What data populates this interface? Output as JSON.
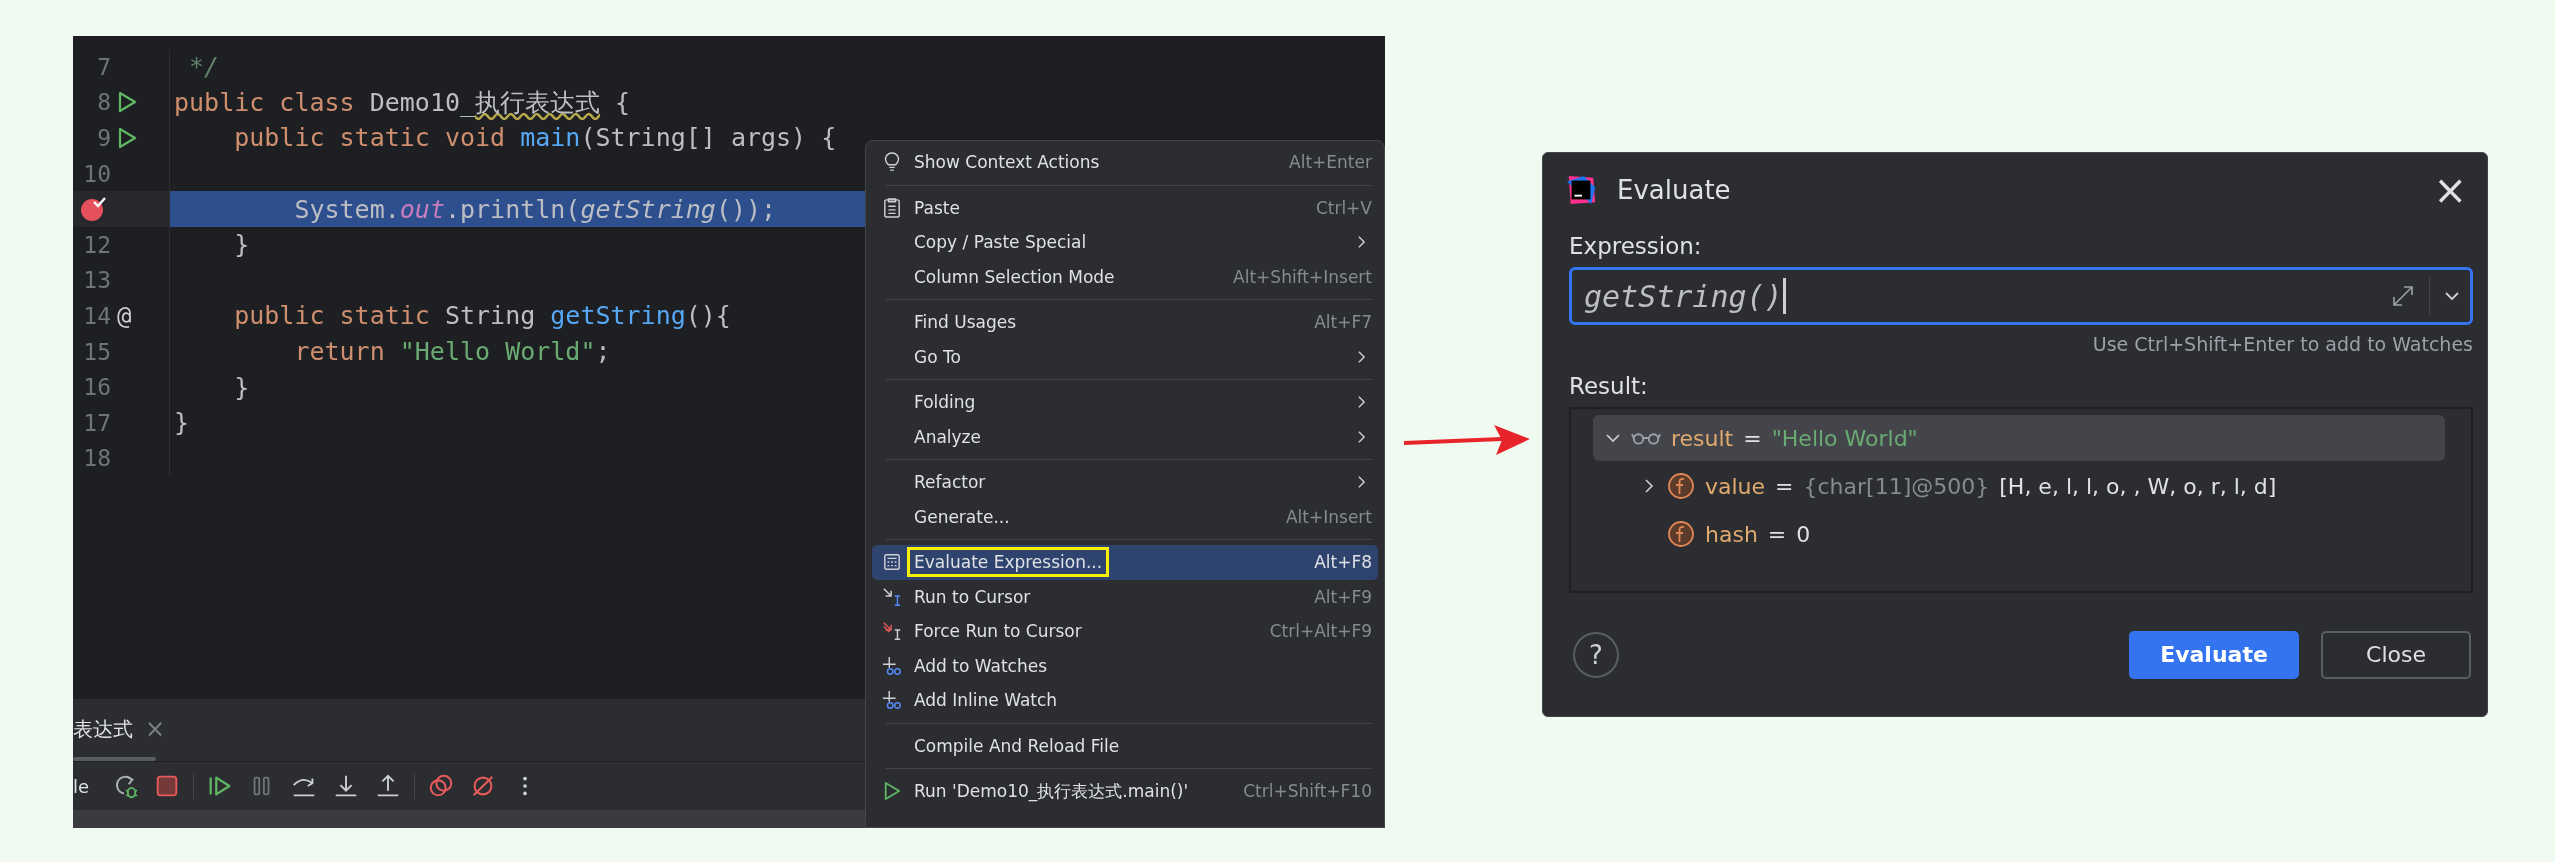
{
  "editor": {
    "lines": [
      {
        "number": "7",
        "kind": "plain",
        "selected": false,
        "tokens": [
          {
            "kind": "comment",
            "text": " */"
          }
        ]
      },
      {
        "number": "8",
        "kind": "run",
        "selected": false,
        "tokens": [
          {
            "kind": "keyword",
            "text": "public"
          },
          {
            "kind": "keyword",
            "text": " class"
          },
          {
            "kind": "plain",
            "text": " Demo10_"
          },
          {
            "kind": "warn",
            "text": "执行表达式"
          },
          {
            "kind": "plain",
            "text": " {"
          }
        ]
      },
      {
        "number": "9",
        "kind": "run",
        "selected": false,
        "tokens": [
          {
            "kind": "keyword",
            "text": "    public static void"
          },
          {
            "kind": "decl",
            "text": " main"
          },
          {
            "kind": "plain",
            "text": "(String[] args) {"
          }
        ]
      },
      {
        "number": "10",
        "kind": "plain",
        "selected": false
      },
      {
        "kind": "breakpoint",
        "selected": true,
        "tokens": [
          {
            "kind": "plain",
            "text": "        System."
          },
          {
            "kind": "field",
            "text": "out"
          },
          {
            "kind": "plain",
            "text": ".println("
          },
          {
            "kind": "call",
            "text": "getString"
          },
          {
            "kind": "plain",
            "text": "());"
          }
        ]
      },
      {
        "number": "12",
        "kind": "plain",
        "selected": false,
        "tokens": [
          {
            "kind": "plain",
            "text": "    }"
          }
        ]
      },
      {
        "number": "13",
        "kind": "plain",
        "selected": false
      },
      {
        "number": "14",
        "kind": "symbol",
        "symbol": "@",
        "selected": false,
        "tokens": [
          {
            "kind": "keyword",
            "text": "    public static"
          },
          {
            "kind": "plain",
            "text": " String "
          },
          {
            "kind": "decl",
            "text": "getString"
          },
          {
            "kind": "plain",
            "text": "(){"
          }
        ]
      },
      {
        "number": "15",
        "kind": "plain",
        "selected": false,
        "tokens": [
          {
            "kind": "keyword",
            "text": "        return"
          },
          {
            "kind": "string",
            "text": " \"Hello World\""
          },
          {
            "kind": "plain",
            "text": ";"
          }
        ]
      },
      {
        "number": "16",
        "kind": "plain",
        "selected": false,
        "tokens": [
          {
            "kind": "plain",
            "text": "    }"
          }
        ]
      },
      {
        "number": "17",
        "kind": "plain",
        "selected": false,
        "tokens": [
          {
            "kind": "plain",
            "text": "}"
          }
        ]
      },
      {
        "number": "18",
        "kind": "plain",
        "selected": false
      }
    ]
  },
  "context_menu": {
    "items": [
      {
        "kind": "item",
        "label": "Show Context Actions",
        "shortcut": "Alt+Enter",
        "submenu": false,
        "selected": false,
        "outlined": false
      },
      {
        "kind": "separator"
      },
      {
        "kind": "item",
        "label": "Paste",
        "shortcut": "Ctrl+V",
        "submenu": false,
        "selected": false,
        "outlined": false
      },
      {
        "kind": "item",
        "label": "Copy / Paste Special",
        "submenu": true,
        "selected": false,
        "outlined": false
      },
      {
        "kind": "item",
        "label": "Column Selection Mode",
        "shortcut": "Alt+Shift+Insert",
        "submenu": false,
        "selected": false,
        "outlined": false
      },
      {
        "kind": "separator"
      },
      {
        "kind": "item",
        "label": "Find Usages",
        "shortcut": "Alt+F7",
        "submenu": false,
        "selected": false,
        "outlined": false
      },
      {
        "kind": "item",
        "label": "Go To",
        "submenu": true,
        "selected": false,
        "outlined": false
      },
      {
        "kind": "separator"
      },
      {
        "kind": "item",
        "label": "Folding",
        "submenu": true,
        "selected": false,
        "outlined": false
      },
      {
        "kind": "item",
        "label": "Analyze",
        "submenu": true,
        "selected": false,
        "outlined": false
      },
      {
        "kind": "separator"
      },
      {
        "kind": "item",
        "label": "Refactor",
        "submenu": true,
        "selected": false,
        "outlined": false
      },
      {
        "kind": "item",
        "label": "Generate...",
        "shortcut": "Alt+Insert",
        "submenu": false,
        "selected": false,
        "outlined": false
      },
      {
        "kind": "separator"
      },
      {
        "kind": "item",
        "label": "Evaluate Expression...",
        "shortcut": "Alt+F8",
        "submenu": false,
        "selected": true,
        "outlined": true
      },
      {
        "kind": "item",
        "label": "Run to Cursor",
        "shortcut": "Alt+F9",
        "submenu": false,
        "selected": false,
        "outlined": false
      },
      {
        "kind": "item",
        "label": "Force Run to Cursor",
        "shortcut": "Ctrl+Alt+F9",
        "submenu": false,
        "selected": false,
        "outlined": false
      },
      {
        "kind": "item",
        "label": "Add to Watches",
        "submenu": false,
        "selected": false,
        "outlined": false
      },
      {
        "kind": "item",
        "label": "Add Inline Watch",
        "submenu": false,
        "selected": false,
        "outlined": false
      },
      {
        "kind": "separator"
      },
      {
        "kind": "item",
        "label": "Compile And Reload File",
        "submenu": false,
        "selected": false,
        "outlined": false
      },
      {
        "kind": "separator"
      },
      {
        "kind": "item",
        "label": "Run 'Demo10_执行表达式.main()'",
        "shortcut": "Ctrl+Shift+F10",
        "submenu": false,
        "selected": false,
        "outlined": false
      }
    ]
  },
  "debug_panel": {
    "tab": {
      "label": "表达式",
      "close": "×"
    },
    "console_label": "le"
  },
  "dialog": {
    "title": "Evaluate",
    "close": "×",
    "expression_label": "Expression:",
    "expression_value": "getString()",
    "hint": "Use Ctrl+Shift+Enter to add to Watches",
    "result_label": "Result:",
    "result_tree": [
      {
        "expanded": true,
        "kind": "watch",
        "name": "result",
        "operator": "=",
        "value": "\"Hello World\"",
        "selected": true,
        "children": [
          {
            "expanded": false,
            "kind": "field",
            "name": "value",
            "operator": "=",
            "type_hint": "{char[11]@500}",
            "value": "[H, e, l, l, o,  , W, o, r, l, d]",
            "selected": false
          },
          {
            "kind": "field",
            "name": "hash",
            "operator": "=",
            "value": "0",
            "selected": false
          }
        ]
      }
    ],
    "help": "?",
    "buttons": [
      {
        "label": "Evaluate",
        "primary": true
      },
      {
        "label": "Close",
        "primary": false
      }
    ]
  }
}
